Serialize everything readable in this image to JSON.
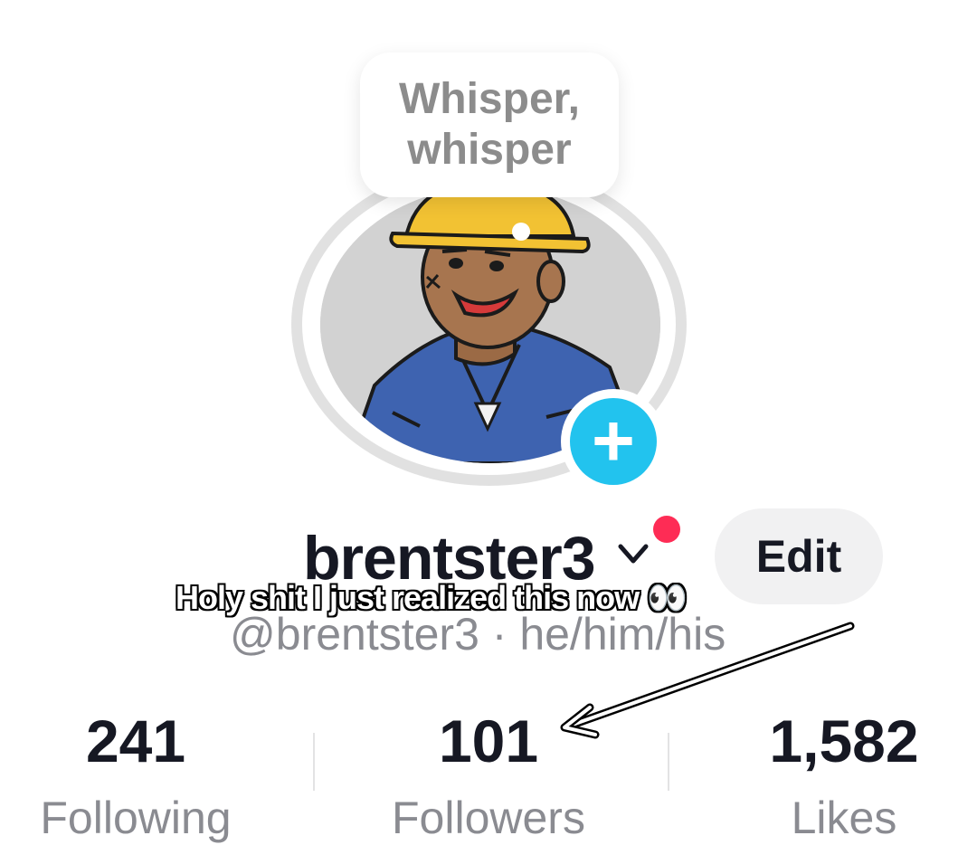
{
  "profile": {
    "username": "brentster3",
    "handle": "@brentster3 · he/him/his",
    "bubble_text_line1": "Whisper,",
    "bubble_text_line2": "whisper",
    "edit_label": "Edit"
  },
  "stats": [
    {
      "value": "241",
      "label": "Following"
    },
    {
      "value": "101",
      "label": "Followers"
    },
    {
      "value": "1,582",
      "label": "Likes"
    }
  ],
  "caption": "Holy shit I just realized this now 👀",
  "icons": {
    "plus": "plus-icon",
    "chevron": "chevron-down-icon",
    "arrow": "arrow-annotation-icon"
  },
  "colors": {
    "accent": "#22c3ee",
    "notification": "#fe2c55",
    "text": "#161823",
    "muted": "#8a8b91"
  }
}
